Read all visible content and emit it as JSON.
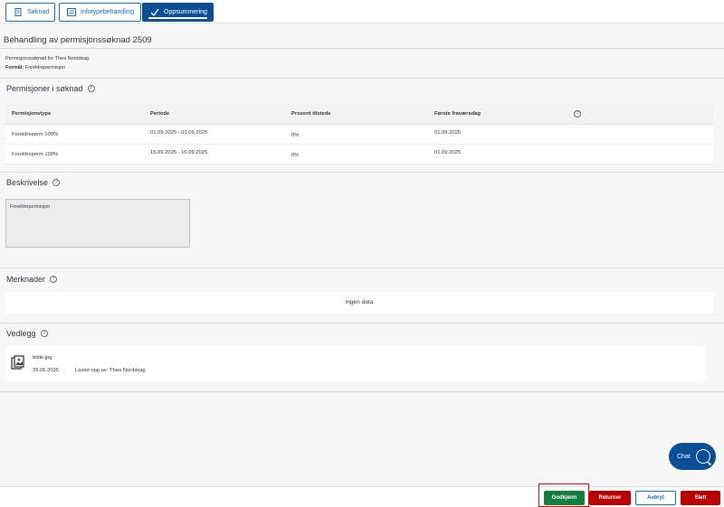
{
  "tabs": [
    {
      "label": "Søknad"
    },
    {
      "label": "Infotypebehandling"
    },
    {
      "label": "Oppsummering"
    }
  ],
  "page_title": "Behandling av permisjonssøknad 2509",
  "info": {
    "applicant_line": "Permisjonssøknad for Thea Nordskag",
    "purpose_label": "Formål:",
    "purpose_value": "Foreldrepermisjon"
  },
  "sections": {
    "permissions_title": "Permisjoner i søknad",
    "description_title": "Beskrivelse",
    "remarks_title": "Merknader",
    "attachments_title": "Vedlegg"
  },
  "table": {
    "headers": [
      "Permisjonstype",
      "Periode",
      "Prosent tilstede",
      "Første fraværsdag"
    ],
    "rows": [
      [
        "Foreldreperm 100%",
        "01.09.2025 - 03.09.2025",
        "0%",
        "01.09.2025"
      ],
      [
        "Foreldreperm 100%",
        "15.09.2025 - 16.09.2025",
        "0%",
        "01.09.2025"
      ]
    ]
  },
  "description_text": "Foreldrepermisjon",
  "remarks_empty": "Ingen data",
  "attachment": {
    "filename": "bilde.jpg",
    "date": "26.06.2025",
    "uploaded_by": "Lastet opp av: Thea Nordskag"
  },
  "chat_label": "Chat",
  "help_glyph": "?",
  "buttons": {
    "approve": "Godkjenn",
    "return": "Returner",
    "cancel": "Avbryt",
    "delete": "Slett"
  },
  "colors": {
    "accent": "#0a6ed1",
    "approve": "#107e3e",
    "reject": "#bb0000"
  }
}
